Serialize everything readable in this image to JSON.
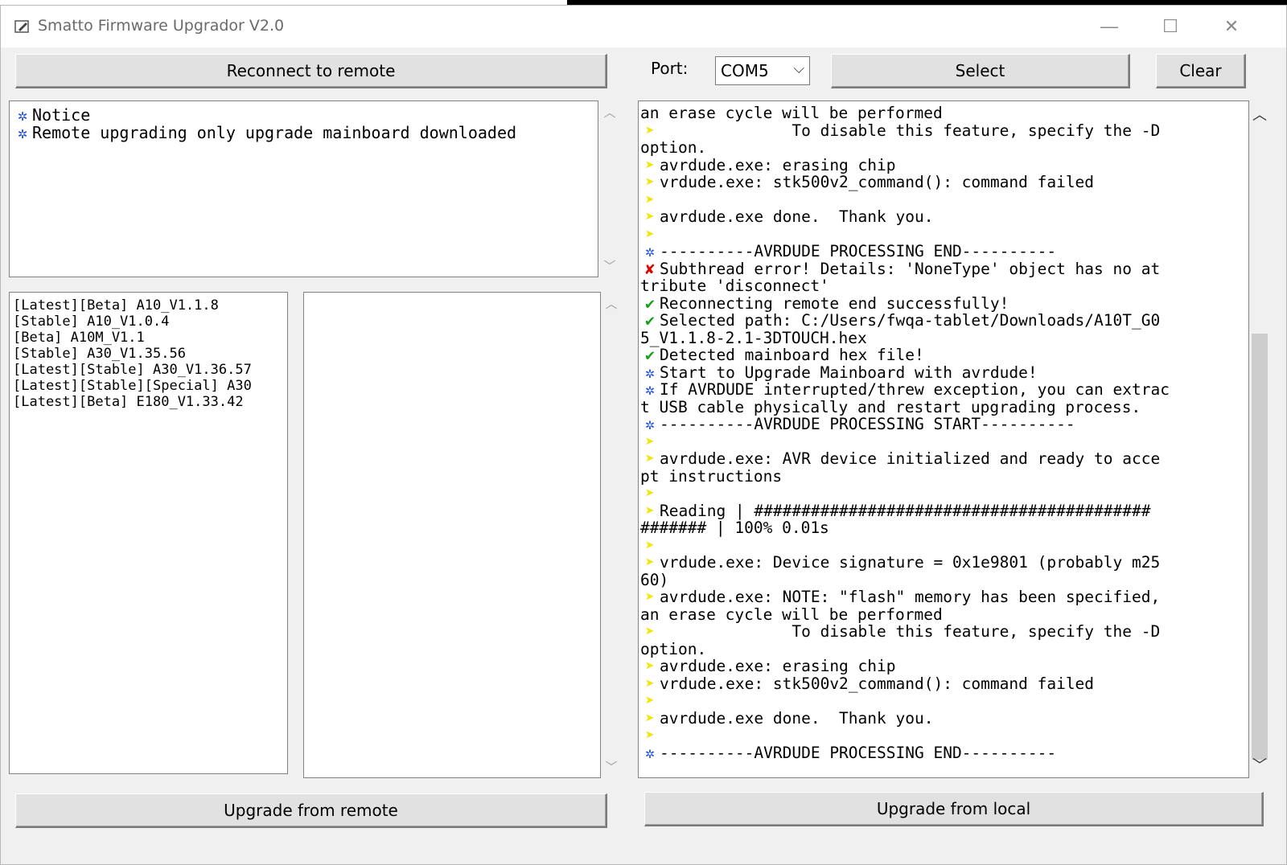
{
  "window": {
    "title": "Smatto Firmware Upgrador V2.0",
    "minimize": "—",
    "maximize": "☐",
    "close": "✕"
  },
  "toolbar": {
    "reconnect_label": "Reconnect to remote",
    "port_label": "Port:",
    "port_value": "COM5",
    "select_label": "Select",
    "clear_label": "Clear"
  },
  "notice": {
    "lines": [
      {
        "icon": "info",
        "text": "Notice"
      },
      {
        "icon": "info",
        "text": "Remote upgrading only upgrade mainboard downloaded"
      }
    ]
  },
  "firmware_list": {
    "items": [
      "[Latest][Beta] A10_V1.1.8",
      "[Stable] A10_V1.0.4",
      "[Beta] A10M_V1.1",
      "[Stable] A30_V1.35.56",
      "[Latest][Stable] A30_V1.36.57",
      "[Latest][Stable][Special] A30",
      "[Latest][Beta] E180_V1.33.42"
    ]
  },
  "log": {
    "lines": [
      {
        "icon": "",
        "text": "an erase cycle will be performed"
      },
      {
        "icon": "arrow",
        "text": "              To disable this feature, specify the -D"
      },
      {
        "icon": "",
        "text": "option."
      },
      {
        "icon": "arrow",
        "text": "avrdude.exe: erasing chip"
      },
      {
        "icon": "arrow",
        "text": "vrdude.exe: stk500v2_command(): command failed"
      },
      {
        "icon": "arrow",
        "text": ""
      },
      {
        "icon": "arrow",
        "text": "avrdude.exe done.  Thank you."
      },
      {
        "icon": "arrow",
        "text": ""
      },
      {
        "icon": "info",
        "text": "----------AVRDUDE PROCESSING END----------"
      },
      {
        "icon": "err",
        "text": "Subthread error! Details: 'NoneType' object has no at"
      },
      {
        "icon": "",
        "text": "tribute 'disconnect'"
      },
      {
        "icon": "ok",
        "text": "Reconnecting remote end successfully!"
      },
      {
        "icon": "ok",
        "text": "Selected path: C:/Users/fwqa-tablet/Downloads/A10T_G0"
      },
      {
        "icon": "",
        "text": "5_V1.1.8-2.1-3DTOUCH.hex"
      },
      {
        "icon": "ok",
        "text": "Detected mainboard hex file!"
      },
      {
        "icon": "info",
        "text": "Start to Upgrade Mainboard with avrdude!"
      },
      {
        "icon": "info",
        "text": "If AVRDUDE interrupted/threw exception, you can extrac"
      },
      {
        "icon": "",
        "text": "t USB cable physically and restart upgrading process."
      },
      {
        "icon": "info",
        "text": "----------AVRDUDE PROCESSING START----------"
      },
      {
        "icon": "arrow",
        "text": ""
      },
      {
        "icon": "arrow",
        "text": "avrdude.exe: AVR device initialized and ready to acce"
      },
      {
        "icon": "",
        "text": "pt instructions"
      },
      {
        "icon": "arrow",
        "text": ""
      },
      {
        "icon": "arrow",
        "text": "Reading | ##########################################"
      },
      {
        "icon": "",
        "text": "####### | 100% 0.01s"
      },
      {
        "icon": "arrow",
        "text": ""
      },
      {
        "icon": "arrow",
        "text": "vrdude.exe: Device signature = 0x1e9801 (probably m25"
      },
      {
        "icon": "",
        "text": "60)"
      },
      {
        "icon": "arrow",
        "text": "avrdude.exe: NOTE: \"flash\" memory has been specified,"
      },
      {
        "icon": "",
        "text": "an erase cycle will be performed"
      },
      {
        "icon": "arrow",
        "text": "              To disable this feature, specify the -D"
      },
      {
        "icon": "",
        "text": "option."
      },
      {
        "icon": "arrow",
        "text": "avrdude.exe: erasing chip"
      },
      {
        "icon": "arrow",
        "text": "vrdude.exe: stk500v2_command(): command failed"
      },
      {
        "icon": "arrow",
        "text": ""
      },
      {
        "icon": "arrow",
        "text": "avrdude.exe done.  Thank you."
      },
      {
        "icon": "arrow",
        "text": ""
      },
      {
        "icon": "info",
        "text": "----------AVRDUDE PROCESSING END----------"
      }
    ]
  },
  "footer": {
    "upgrade_remote_label": "Upgrade from remote",
    "upgrade_local_label": "Upgrade from local"
  },
  "icons": {
    "info": "✲",
    "arrow": "➤",
    "err": "✘",
    "ok": "✔"
  }
}
